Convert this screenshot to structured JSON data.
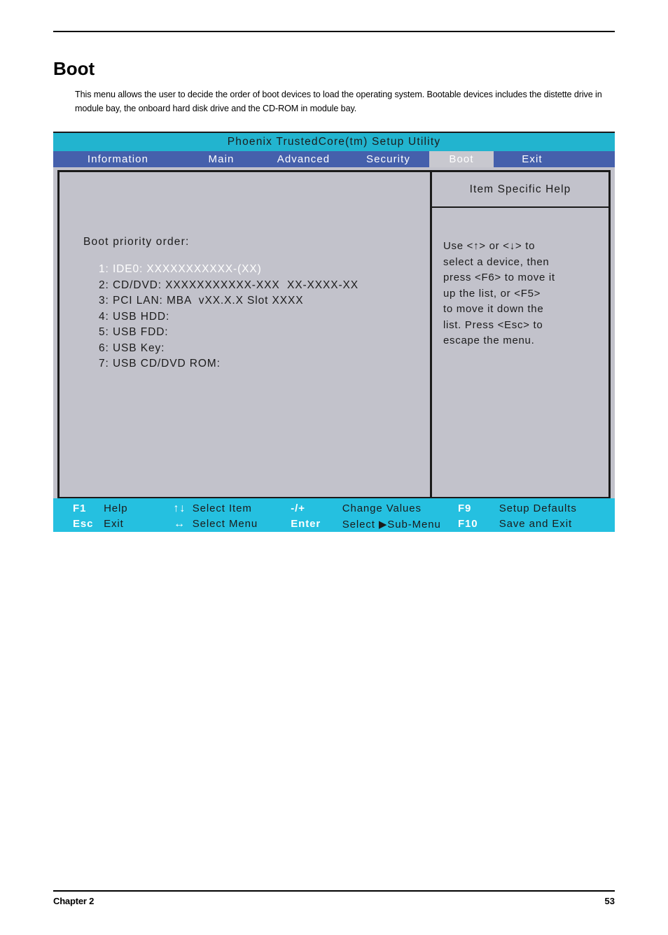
{
  "document": {
    "heading": "Boot",
    "intro": "This menu allows the user to decide the order of boot devices to load the operating system. Bootable devices includes the distette drive in module bay, the onboard hard disk drive and the CD-ROM in module bay.",
    "footer_left": "Chapter 2",
    "footer_right": "53"
  },
  "bios": {
    "title": "Phoenix TrustedCore(tm) Setup Utility",
    "menu": [
      {
        "label": "Information",
        "active": false
      },
      {
        "label": "Main",
        "active": false
      },
      {
        "label": "Advanced",
        "active": false
      },
      {
        "label": "Security",
        "active": false
      },
      {
        "label": "Boot",
        "active": true
      },
      {
        "label": "Exit",
        "active": false
      }
    ],
    "boot_order_label": "Boot priority order:",
    "boot_items": [
      {
        "index": "1:",
        "label": "IDE0: XXXXXXXXXXX-(XX)",
        "selected": true
      },
      {
        "index": "2:",
        "label": "CD/DVD: XXXXXXXXXXX-XXX  XX-XXXX-XX",
        "selected": false
      },
      {
        "index": "3:",
        "label": "PCI LAN: MBA  vXX.X.X Slot XXXX",
        "selected": false
      },
      {
        "index": "4:",
        "label": "USB HDD:",
        "selected": false
      },
      {
        "index": "5:",
        "label": "USB FDD:",
        "selected": false
      },
      {
        "index": "6:",
        "label": "USB Key:",
        "selected": false
      },
      {
        "index": "7:",
        "label": "USB CD/DVD ROM:",
        "selected": false
      }
    ],
    "help": {
      "title": "Item Specific Help",
      "text": "Use <↑> or <↓> to\nselect a device, then\npress <F6> to move it\nup the list, or <F5>\nto move it down the\nlist. Press <Esc> to\nescape the menu."
    },
    "function_keys": {
      "row1": {
        "key": "F1",
        "action": "Help",
        "nav_symbol": "↑↓",
        "nav_action": "Select Item",
        "value_key": "-/+",
        "value_action": "Change Values",
        "defaults_key": "F9",
        "defaults_action": "Setup Defaults"
      },
      "row2": {
        "key": "Esc",
        "action": "Exit",
        "nav_symbol": "↔",
        "nav_action": "Select Menu",
        "value_key": "Enter",
        "value_action": "Select  ▶Sub-Menu",
        "defaults_key": "F10",
        "defaults_action": "Save and Exit"
      }
    },
    "colors": {
      "title_bar": "#22b4cf",
      "menu_bar": "#4560ac",
      "active_tab": "#c8c8cf",
      "body": "#c2c2cb",
      "function_bar": "#25c0e0"
    }
  }
}
